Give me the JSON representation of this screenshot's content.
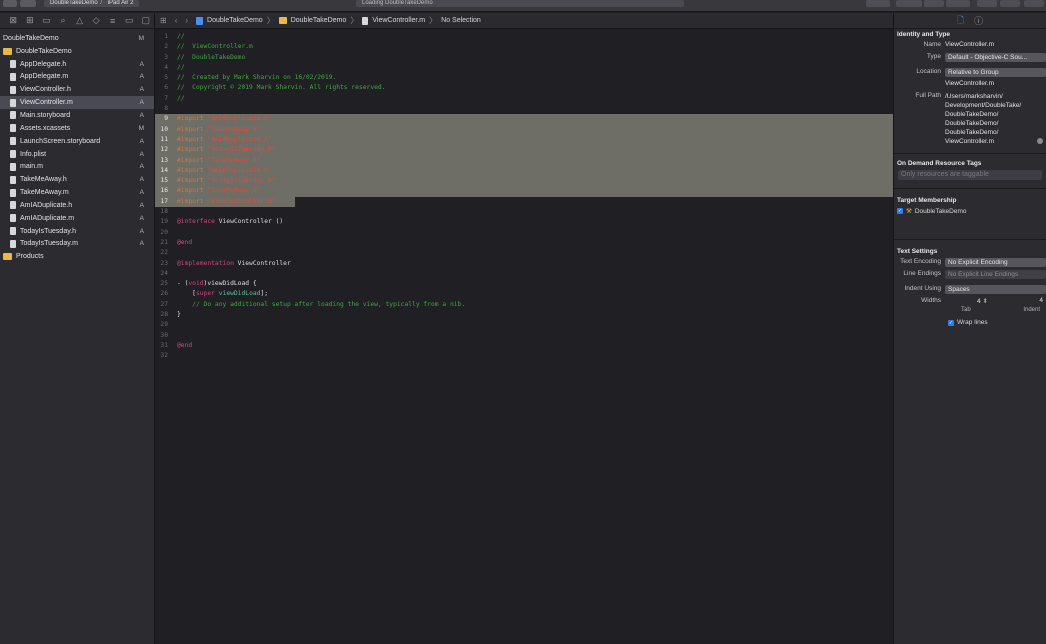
{
  "toolbar": {
    "scheme": "DoubleTakeDemo",
    "destination": "iPad Air 2",
    "activity": "Loading DoubleTakeDemo"
  },
  "navigator": {
    "files": [
      {
        "name": "DoubleTakeDemo",
        "status": "M",
        "indent": 0,
        "kind": "project"
      },
      {
        "name": "DoubleTakeDemo",
        "status": "",
        "indent": 0,
        "kind": "folder"
      },
      {
        "name": "AppDelegate.h",
        "status": "A",
        "indent": 1,
        "kind": "file"
      },
      {
        "name": "AppDelegate.m",
        "status": "A",
        "indent": 1,
        "kind": "file"
      },
      {
        "name": "ViewController.h",
        "status": "A",
        "indent": 1,
        "kind": "file"
      },
      {
        "name": "ViewController.m",
        "status": "A",
        "indent": 1,
        "kind": "file",
        "selected": true
      },
      {
        "name": "Main.storyboard",
        "status": "A",
        "indent": 1,
        "kind": "file"
      },
      {
        "name": "Assets.xcassets",
        "status": "M",
        "indent": 1,
        "kind": "file"
      },
      {
        "name": "LaunchScreen.storyboard",
        "status": "A",
        "indent": 1,
        "kind": "file"
      },
      {
        "name": "Info.plist",
        "status": "A",
        "indent": 1,
        "kind": "file"
      },
      {
        "name": "main.m",
        "status": "A",
        "indent": 1,
        "kind": "file"
      },
      {
        "name": "TakeMeAway.h",
        "status": "A",
        "indent": 1,
        "kind": "file"
      },
      {
        "name": "TakeMeAway.m",
        "status": "A",
        "indent": 1,
        "kind": "file"
      },
      {
        "name": "AmIADuplicate.h",
        "status": "A",
        "indent": 1,
        "kind": "file"
      },
      {
        "name": "AmIADuplicate.m",
        "status": "A",
        "indent": 1,
        "kind": "file"
      },
      {
        "name": "TodayIsTuesday.h",
        "status": "A",
        "indent": 1,
        "kind": "file"
      },
      {
        "name": "TodayIsTuesday.m",
        "status": "A",
        "indent": 1,
        "kind": "file"
      },
      {
        "name": "Products",
        "status": "",
        "indent": 0,
        "kind": "folder"
      }
    ]
  },
  "jumpbar": {
    "crumbs": [
      "DoubleTakeDemo",
      "DoubleTakeDemo",
      "ViewController.m",
      "No Selection"
    ]
  },
  "editor": {
    "lines": [
      {
        "n": "1",
        "hl": false,
        "segs": [
          [
            "cmt",
            "//"
          ]
        ]
      },
      {
        "n": "2",
        "hl": false,
        "segs": [
          [
            "cmt",
            "//  ViewController.m"
          ]
        ]
      },
      {
        "n": "3",
        "hl": false,
        "segs": [
          [
            "cmt",
            "//  DoubleTakeDemo"
          ]
        ]
      },
      {
        "n": "4",
        "hl": false,
        "segs": [
          [
            "cmt",
            "//"
          ]
        ]
      },
      {
        "n": "5",
        "hl": false,
        "segs": [
          [
            "cmt",
            "//  Created by Mark Sharvin on 16/02/2019."
          ]
        ]
      },
      {
        "n": "6",
        "hl": false,
        "segs": [
          [
            "cmt",
            "//  Copyright © 2019 Mark Sharvin. All rights reserved."
          ]
        ]
      },
      {
        "n": "7",
        "hl": false,
        "segs": [
          [
            "cmt",
            "//"
          ]
        ]
      },
      {
        "n": "8",
        "hl": false,
        "segs": []
      },
      {
        "n": "9",
        "hl": true,
        "segs": [
          [
            "pp",
            "#import "
          ],
          [
            "str",
            "\"AmIADuplicate.h\""
          ]
        ]
      },
      {
        "n": "10",
        "hl": true,
        "segs": [
          [
            "pp",
            "#import "
          ],
          [
            "str",
            "\"TakeMeAway.h\""
          ]
        ]
      },
      {
        "n": "11",
        "hl": true,
        "segs": [
          [
            "pp",
            "#import "
          ],
          [
            "str",
            "\"AmIADuplicate.h\""
          ]
        ]
      },
      {
        "n": "12",
        "hl": true,
        "segs": [
          [
            "pp",
            "#import "
          ],
          [
            "str",
            "\"TodayIsTuesday.h\""
          ]
        ]
      },
      {
        "n": "13",
        "hl": true,
        "segs": [
          [
            "pp",
            "#import "
          ],
          [
            "str",
            "\"TakeMeAway.h\""
          ]
        ]
      },
      {
        "n": "14",
        "hl": true,
        "segs": [
          [
            "pp",
            "#import "
          ],
          [
            "str",
            "\"AmIADuplicate.h\""
          ]
        ]
      },
      {
        "n": "15",
        "hl": true,
        "segs": [
          [
            "pp",
            "#import "
          ],
          [
            "str",
            "\"TodayIsTuesday.h\""
          ]
        ]
      },
      {
        "n": "16",
        "hl": true,
        "segs": [
          [
            "pp",
            "#import "
          ],
          [
            "str",
            "\"TakeMeAway.h\""
          ]
        ]
      },
      {
        "n": "17",
        "hl": true,
        "partial": true,
        "segs": [
          [
            "pp",
            "#import "
          ],
          [
            "str",
            "\"ViewController.h\""
          ]
        ]
      },
      {
        "n": "18",
        "hl": false,
        "segs": []
      },
      {
        "n": "19",
        "hl": false,
        "segs": [
          [
            "kw",
            "@interface "
          ],
          [
            "ty",
            "ViewController ()"
          ]
        ]
      },
      {
        "n": "20",
        "hl": false,
        "segs": []
      },
      {
        "n": "21",
        "hl": false,
        "segs": [
          [
            "kw",
            "@end"
          ]
        ]
      },
      {
        "n": "22",
        "hl": false,
        "segs": []
      },
      {
        "n": "23",
        "hl": false,
        "segs": [
          [
            "kw",
            "@implementation "
          ],
          [
            "ty",
            "ViewController"
          ]
        ]
      },
      {
        "n": "24",
        "hl": false,
        "segs": []
      },
      {
        "n": "25",
        "hl": false,
        "segs": [
          [
            "fn",
            "- ("
          ],
          [
            "kw",
            "void"
          ],
          [
            "fn",
            ")viewDidLoad {"
          ]
        ]
      },
      {
        "n": "26",
        "hl": false,
        "segs": [
          [
            "fn",
            "    ["
          ],
          [
            "kw",
            "super"
          ],
          [
            "fn",
            " "
          ],
          [
            "sup",
            "viewDidLoad"
          ],
          [
            "fn",
            "];"
          ]
        ]
      },
      {
        "n": "27",
        "hl": false,
        "segs": [
          [
            "cmt",
            "    // Do any additional setup after loading the view, typically from a nib."
          ]
        ]
      },
      {
        "n": "28",
        "hl": false,
        "segs": [
          [
            "fn",
            "}"
          ]
        ]
      },
      {
        "n": "29",
        "hl": false,
        "segs": []
      },
      {
        "n": "30",
        "hl": false,
        "segs": []
      },
      {
        "n": "31",
        "hl": false,
        "segs": [
          [
            "kw",
            "@end"
          ]
        ]
      },
      {
        "n": "32",
        "hl": false,
        "segs": []
      }
    ]
  },
  "inspector": {
    "identity_title": "Identity and Type",
    "name_label": "Name",
    "name_value": "ViewController.m",
    "type_label": "Type",
    "type_value": "Default - Objective-C Sou...",
    "location_label": "Location",
    "location_value": "Relative to Group",
    "location_file": "ViewController.m",
    "fullpath_label": "Full Path",
    "fullpath_lines": [
      "/Users/marksharvin/",
      "Development/DoubleTake/",
      "DoubleTakeDemo/",
      "DoubleTakeDemo/",
      "DoubleTakeDemo/",
      "ViewController.m"
    ],
    "odr_title": "On Demand Resource Tags",
    "odr_placeholder": "Only resources are taggable",
    "target_title": "Target Membership",
    "target_name": "DoubleTakeDemo",
    "text_title": "Text Settings",
    "encoding_label": "Text Encoding",
    "encoding_value": "No Explicit Encoding",
    "endings_label": "Line Endings",
    "endings_value": "No Explicit Line Endings",
    "indent_label": "Indent Using",
    "indent_value": "Spaces",
    "widths_label": "Widths",
    "tab_width": "4",
    "indent_width": "4",
    "tab_caption": "Tab",
    "indent_caption": "Indent",
    "wrap_label": "Wrap lines"
  }
}
